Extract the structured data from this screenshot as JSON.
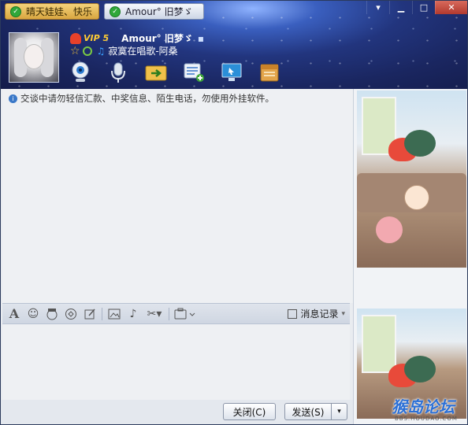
{
  "window": {
    "tabs": [
      {
        "label": "晴天娃娃、快乐",
        "active": true
      },
      {
        "label": "Amour°   旧梦ゞ",
        "active": false
      }
    ],
    "controls": {
      "menu": "▾",
      "minimize": "▁",
      "maximize": "□",
      "close": "✕"
    }
  },
  "contact": {
    "vip_label": "VIP 5",
    "nickname": "Amour°   旧梦ゞ",
    "status_dot": "▪",
    "signature": "寂寞在唱歌-阿桑"
  },
  "toolbar_top": {
    "icons": [
      "webcam-icon",
      "microphone-icon",
      "file-transfer-icon",
      "message-add-icon",
      "remote-desktop-icon",
      "app-box-icon"
    ]
  },
  "chat": {
    "notice": "交谈中请勿轻信汇款、中奖信息、陌生电话，勿使用外挂软件。"
  },
  "input_toolbar": {
    "icons": [
      "font-icon",
      "emoji-icon",
      "magic-face-icon",
      "shake-icon",
      "edit-icon",
      "image-icon",
      "music-icon",
      "screenshot-icon",
      "apps-icon"
    ],
    "history_label": "消息记录"
  },
  "buttons": {
    "close_label": "关闭(C)",
    "send_label": "发送(S)",
    "send_menu": "▾"
  },
  "watermark": {
    "logo": "猴岛论坛",
    "url": "BBS.HOUDAO.COM"
  },
  "colors": {
    "header_bg": "#22357e",
    "active_tab": "#d9a640",
    "close_button": "#b1392e"
  }
}
